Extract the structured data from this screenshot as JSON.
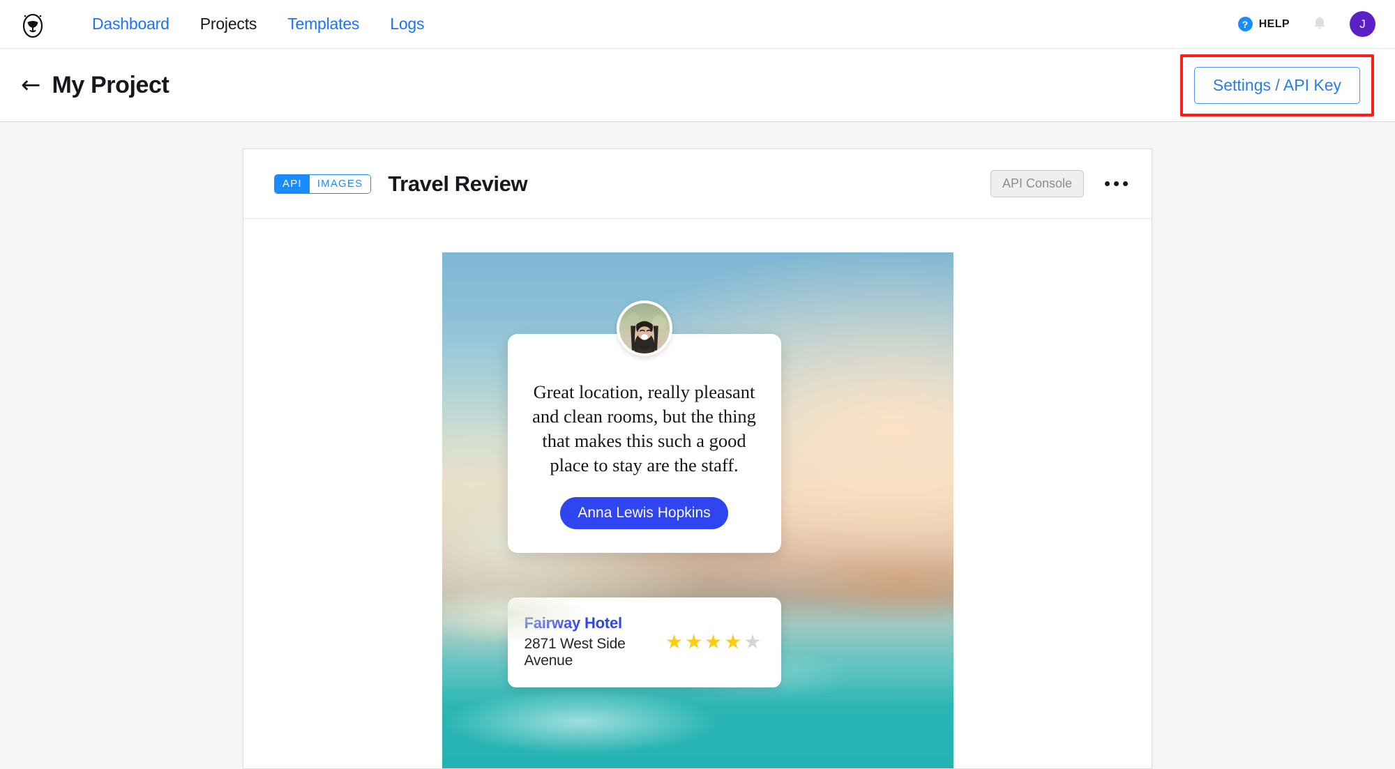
{
  "topnav": {
    "logo_icon": "egg-mascot-logo",
    "links": [
      {
        "label": "Dashboard",
        "active": false
      },
      {
        "label": "Projects",
        "active": true
      },
      {
        "label": "Templates",
        "active": false
      },
      {
        "label": "Logs",
        "active": false
      }
    ],
    "help": {
      "label": "HELP",
      "mark": "?",
      "icon": "help-question-icon"
    },
    "bell_icon": "notification-bell-icon",
    "avatar": {
      "initial": "J",
      "color": "#5b21c9"
    }
  },
  "projectbar": {
    "back_arrow": "←",
    "title": "My Project",
    "settings_label": "Settings / API Key",
    "highlight_color": "#ff1d15"
  },
  "card": {
    "badge": {
      "left": "API",
      "right": "IMAGES"
    },
    "title": "Travel Review",
    "api_console_label": "API Console",
    "kebab_icon": "more-options-icon"
  },
  "preview": {
    "avatar_alt": "smiling-woman-avatar",
    "quote": "Great location, really pleasant and clean rooms, but the thing that makes this such a good place to stay are the staff.",
    "author": "Anna Lewis Hopkins",
    "hotel": {
      "name": "Fairway Hotel",
      "address": "2871 West Side Avenue",
      "rating": 4,
      "max_rating": 5,
      "star_filled_color": "#fdcb12",
      "star_empty_color": "#d3d5d9"
    },
    "accent_color": "#2f45f0"
  }
}
